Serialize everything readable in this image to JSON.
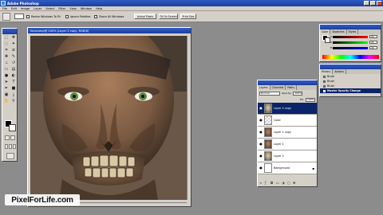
{
  "app": {
    "title": "Adobe Photoshop"
  },
  "menu": [
    "File",
    "Edit",
    "Image",
    "Layer",
    "Select",
    "Filter",
    "View",
    "Window",
    "Help"
  ],
  "options_bar": {
    "checkbox_label_1": "Resize Windows To Fit",
    "checkbox_label_2": "Ignore Palettes",
    "checkbox_label_3": "Zoom All Windows",
    "btn_actual": "Actual Pixels",
    "btn_fit": "Fit On Screen",
    "btn_print": "Print Size"
  },
  "document": {
    "title": "facecomp@ 240% (Layer 2 copy, RGB/8)"
  },
  "layers": {
    "tabs": [
      "Layers",
      "Channels",
      "Paths"
    ],
    "blend_mode": "Normal",
    "opacity_label": "Opacity:",
    "opacity_value": "100%",
    "fill_label": "Fill:",
    "fill_value": "100%",
    "rows": [
      {
        "name": "Layer 2 copy",
        "thumb": "skull",
        "selected": true
      },
      {
        "name": "Color",
        "thumb": "blank",
        "selected": false
      },
      {
        "name": "Layer 1 copy",
        "thumb": "face",
        "selected": false
      },
      {
        "name": "Layer 1",
        "thumb": "face",
        "selected": false
      },
      {
        "name": "Layer 2",
        "thumb": "skull",
        "selected": false
      },
      {
        "name": "Background",
        "thumb": "blank",
        "selected": false
      }
    ]
  },
  "color_palette": {
    "tabs": [
      "Color",
      "Swatches",
      "Styles"
    ],
    "r_label": "R",
    "g_label": "G",
    "b_label": "B",
    "r_value": "24",
    "g_value": "24",
    "b_value": "24"
  },
  "history": {
    "tabs": [
      "History",
      "Actions"
    ],
    "items": [
      {
        "name": "Brush",
        "selected": false
      },
      {
        "name": "Brush",
        "selected": false
      },
      {
        "name": "Brush",
        "selected": false
      },
      {
        "name": "Master Opacity Change",
        "selected": true
      }
    ]
  },
  "watermark": {
    "text": "PixelForLife.com"
  }
}
